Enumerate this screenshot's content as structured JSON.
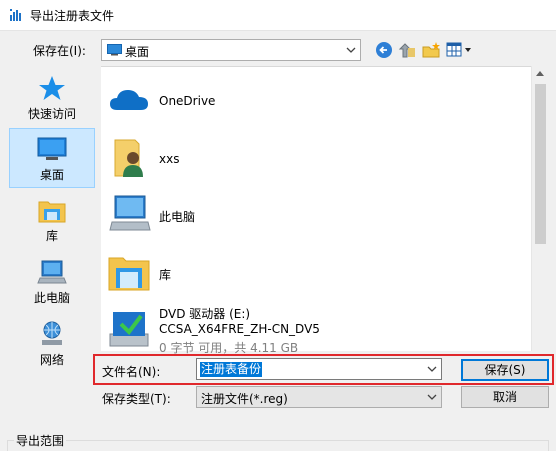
{
  "window": {
    "title": "导出注册表文件"
  },
  "toolbar": {
    "lookin_label": "保存在(I):",
    "lookin_value": "桌面"
  },
  "places": [
    {
      "label": "快速访问",
      "icon": "star-icon"
    },
    {
      "label": "桌面",
      "icon": "desktop-icon",
      "selected": true
    },
    {
      "label": "库",
      "icon": "library-icon"
    },
    {
      "label": "此电脑",
      "icon": "computer-icon"
    },
    {
      "label": "网络",
      "icon": "network-icon"
    }
  ],
  "files": [
    {
      "name": "OneDrive",
      "icon": "cloud-icon"
    },
    {
      "name": "xxs",
      "icon": "user-folder-icon"
    },
    {
      "name": "此电脑",
      "icon": "computer-icon"
    },
    {
      "name": "库",
      "icon": "library-icon"
    },
    {
      "name": "DVD 驱动器 (E:)",
      "line2": "CCSA_X64FRE_ZH-CN_DV5",
      "line3": "0 字节 可用，共 4.11 GB",
      "icon": "dvd-drive-icon"
    }
  ],
  "form": {
    "filename_label": "文件名(N):",
    "filename_value": "注册表备份",
    "filetype_label": "保存类型(T):",
    "filetype_value": "注册文件(*.reg)",
    "save_label": "保存(S)",
    "cancel_label": "取消"
  },
  "export_range": {
    "label": "导出范围"
  },
  "colors": {
    "selection": "#0078d7",
    "highlight": "#e0282c",
    "accent_folder": "#f8d775"
  }
}
